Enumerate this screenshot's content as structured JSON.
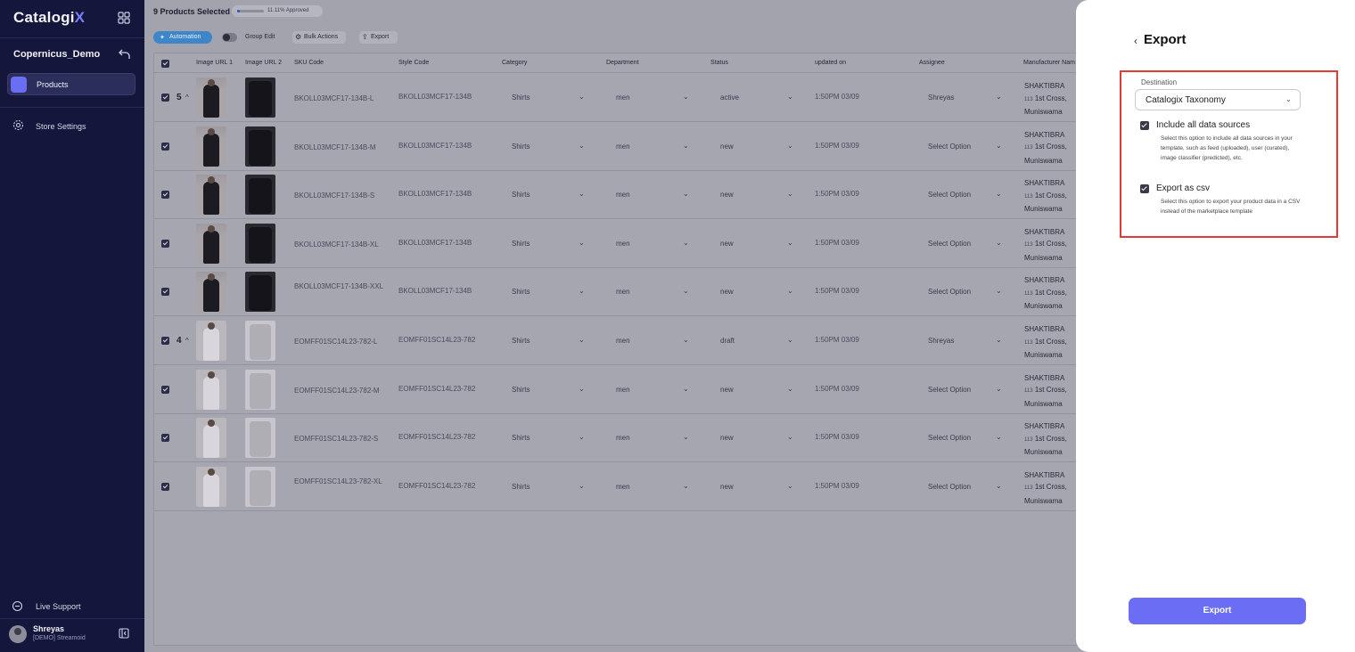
{
  "sidebar": {
    "brand_main": "Catalogi",
    "brand_accent": "X",
    "store_name": "Copernicus_Demo",
    "nav": [
      {
        "label": "Products"
      },
      {
        "label": "Store Settings"
      }
    ],
    "live_support": "Live Support",
    "user": {
      "name": "Shreyas",
      "org": "[DEMO] Streamoid"
    }
  },
  "main": {
    "selection_count": "9 Products Selected",
    "approved": {
      "label": "11.11% Approved",
      "fraction": 0.1111
    },
    "toolbar": {
      "automation": "Automation",
      "group_edit": "Group Edit",
      "bulk_actions": "Bulk Actions",
      "export": "Export"
    },
    "table": {
      "headers": [
        "Image URL 1",
        "Image URL 2",
        "SKU Code",
        "Style Code",
        "Category",
        "Department",
        "Status",
        "updated on",
        "Assignee",
        "Manufacturer Nam"
      ],
      "rows": [
        {
          "group": "5",
          "sku": "BKOLL03MCF17-134B-L",
          "style": "BKOLL03MCF17-134B",
          "category": "Shirts",
          "department": "men",
          "status": "active",
          "updated": "1:50PM 03/09",
          "assignee": "Shreyas",
          "mfr": [
            "SHAKTIBRA",
            "1st Cross,",
            "Muniswama"
          ],
          "mfr_prefix": "113",
          "img": "dark"
        },
        {
          "group": "",
          "sku": "BKOLL03MCF17-134B-M",
          "style": "BKOLL03MCF17-134B",
          "category": "Shirts",
          "department": "men",
          "status": "new",
          "updated": "1:50PM 03/09",
          "assignee": "Select Option",
          "mfr": [
            "SHAKTIBRA",
            "1st Cross,",
            "Muniswama"
          ],
          "mfr_prefix": "113",
          "img": "dark"
        },
        {
          "group": "",
          "sku": "BKOLL03MCF17-134B-S",
          "style": "BKOLL03MCF17-134B",
          "category": "Shirts",
          "department": "men",
          "status": "new",
          "updated": "1:50PM 03/09",
          "assignee": "Select Option",
          "mfr": [
            "SHAKTIBRA",
            "1st Cross,",
            "Muniswama"
          ],
          "mfr_prefix": "113",
          "img": "dark"
        },
        {
          "group": "",
          "sku": "BKOLL03MCF17-134B-XL",
          "style": "BKOLL03MCF17-134B",
          "category": "Shirts",
          "department": "men",
          "status": "new",
          "updated": "1:50PM 03/09",
          "assignee": "Select Option",
          "mfr": [
            "SHAKTIBRA",
            "1st Cross,",
            "Muniswama"
          ],
          "mfr_prefix": "113",
          "img": "dark"
        },
        {
          "group": "",
          "sku": "BKOLL03MCF17-134B-XXL",
          "style": "BKOLL03MCF17-134B",
          "category": "Shirts",
          "department": "men",
          "status": "new",
          "updated": "1:50PM 03/09",
          "assignee": "Select Option",
          "mfr": [
            "SHAKTIBRA",
            "1st Cross,",
            "Muniswama"
          ],
          "mfr_prefix": "113",
          "img": "dark"
        },
        {
          "group": "4",
          "sku": "EOMFF01SC14L23-782-L",
          "style": "EOMFF01SC14L23-782",
          "category": "Shirts",
          "department": "men",
          "status": "draft",
          "updated": "1:50PM 03/09",
          "assignee": "Shreyas",
          "mfr": [
            "SHAKTIBRA",
            "1st Cross,",
            "Muniswama"
          ],
          "mfr_prefix": "113",
          "img": "light"
        },
        {
          "group": "",
          "sku": "EOMFF01SC14L23-782-M",
          "style": "EOMFF01SC14L23-782",
          "category": "Shirts",
          "department": "men",
          "status": "new",
          "updated": "1:50PM 03/09",
          "assignee": "Select Option",
          "mfr": [
            "SHAKTIBRA",
            "1st Cross,",
            "Muniswama"
          ],
          "mfr_prefix": "113",
          "img": "light"
        },
        {
          "group": "",
          "sku": "EOMFF01SC14L23-782-S",
          "style": "EOMFF01SC14L23-782",
          "category": "Shirts",
          "department": "men",
          "status": "new",
          "updated": "1:50PM 03/09",
          "assignee": "Select Option",
          "mfr": [
            "SHAKTIBRA",
            "1st Cross,",
            "Muniswama"
          ],
          "mfr_prefix": "113",
          "img": "light"
        },
        {
          "group": "",
          "sku": "EOMFF01SC14L23-782-XL",
          "style": "EOMFF01SC14L23-782",
          "category": "Shirts",
          "department": "men",
          "status": "new",
          "updated": "1:50PM 03/09",
          "assignee": "Select Option",
          "mfr": [
            "SHAKTIBRA",
            "1st Cross,",
            "Muniswama"
          ],
          "mfr_prefix": "113",
          "img": "light"
        }
      ]
    }
  },
  "export_panel": {
    "title": "Export",
    "destination_label": "Destination",
    "destination_value": "Catalogix Taxonomy",
    "options": [
      {
        "title": "Include all data sources",
        "description": "Select this option to include all data sources in your template, such as feed (uploaded), user (curated), image classifier (predicted), etc.",
        "checked": true
      },
      {
        "title": "Export as csv",
        "description": "Select this option to export your product data in a CSV instead of the marketplace template",
        "checked": true
      }
    ],
    "export_button": "Export"
  },
  "colors": {
    "sidebar_bg": "#15163b",
    "accent": "#6b6ef5",
    "automation": "#3d86c9",
    "highlight": "#e53935"
  },
  "icons": [
    "grid-icon",
    "back-arrow-icon",
    "products-icon",
    "gear-icon",
    "chat-icon",
    "collapse-sidebar-icon",
    "chevron-down-icon",
    "chevron-up-icon",
    "chevron-left-icon",
    "export-icon",
    "bulk-actions-icon",
    "automation-icon"
  ]
}
